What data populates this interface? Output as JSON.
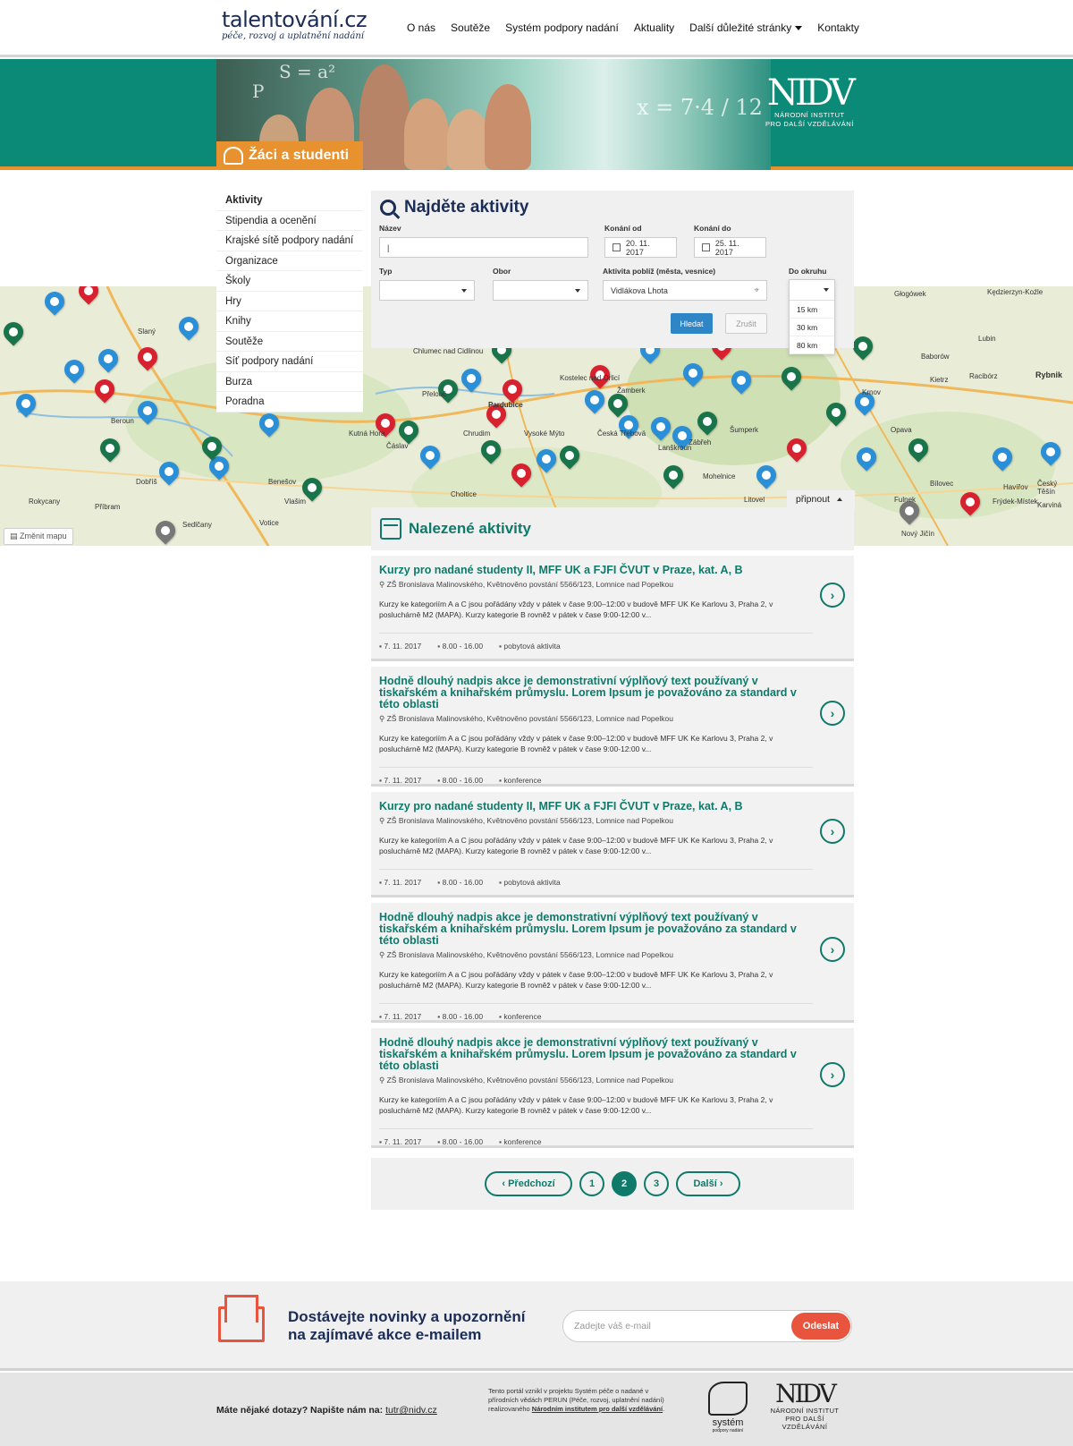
{
  "header": {
    "logo_main": "talentování.cz",
    "logo_sub": "péče, rozvoj a uplatnění nadání",
    "nav": [
      "O nás",
      "Soutěže",
      "Systém podpory nadání",
      "Aktuality",
      "Další důležité stránky",
      "Kontakty"
    ]
  },
  "banner": {
    "label": "Žáci a studenti",
    "nidv_big": "NIDV",
    "nidv_line1": "NÁRODNÍ INSTITUT",
    "nidv_line2": "PRO DALŠÍ VZDĚLÁVÁNÍ",
    "math1": "S = a²",
    "math2": "x = 7·4 / 12",
    "math3": "P"
  },
  "sidebar": {
    "items": [
      "Aktivity",
      "Stipendia a ocenění",
      "Krajské sítě podpory nadání",
      "Organizace",
      "Školy",
      "Hry",
      "Knihy",
      "Soutěže",
      "Síť podpory nadání",
      "Burza",
      "Poradna"
    ]
  },
  "search": {
    "title": "Najděte aktivity",
    "name_label": "Název",
    "name_value": "|",
    "from_label": "Konání od",
    "from_value": "20. 11. 2017",
    "to_label": "Konání do",
    "to_value": "25. 11. 2017",
    "type_label": "Typ",
    "field_label": "Obor",
    "near_label": "Aktivita poblíž (města, vesnice)",
    "near_value": "Vidlákova Lhota",
    "radius_label": "Do okruhu",
    "radius_options": [
      "15 km",
      "30 km",
      "80 km"
    ],
    "search_btn": "Hledat",
    "cancel_btn": "Zrušit"
  },
  "map": {
    "change_map": "Změnit mapu",
    "pin_label": "připnout",
    "cities": [
      "Slaný",
      "Beroun",
      "Příbram",
      "Rokycany",
      "Dobříš",
      "Benešov",
      "Vlašim",
      "Votice",
      "Sedlčany",
      "Kutná Hora",
      "Čáslav",
      "Chrudim",
      "Pardubice",
      "Vysoké Mýto",
      "Česká Třebová",
      "Lanškroun",
      "Zábřeh",
      "Šumperk",
      "Mohelnice",
      "Litovel",
      "Choltice",
      "Přelouč",
      "Kostelec nad Orlicí",
      "Žamberk",
      "Krnov",
      "Opava",
      "Bílovec",
      "Fulnek",
      "Nový Jičín",
      "Frýdek-Místek",
      "Havířov",
      "Český Těšín",
      "Karviná",
      "Rybnik",
      "Racibórz",
      "Kietrz",
      "Baborów",
      "Kędzierzyn-Koźle",
      "Głogówek",
      "Chlumec nad Cidlinou",
      "Lubin"
    ]
  },
  "results": {
    "title": "Nalezené aktivity",
    "cards": [
      {
        "title": "Kurzy pro nadané studenty II, MFF UK a FJFI ČVUT v Praze, kat. A, B",
        "addr": "ZŠ Bronislava Malinovského, Květnověno povstání 5566/123, Lomnice nad Popelkou",
        "desc": "Kurzy ke kategoriím A a C jsou pořádány vždy v pátek v čase 9:00–12:00 v budově MFF UK Ke Karlovu 3, Praha 2, v posluchárně M2 (MAPA). Kurzy kategorie B rovněž v pátek v čase 9:00-12:00 v...",
        "date": "7. 11. 2017",
        "time": "8.00 - 16.00",
        "kind": "pobytová aktivita"
      },
      {
        "title": "Hodně dlouhý nadpis akce je demonstrativní výplňový text používaný v tiskařském a knihařském průmyslu. Lorem Ipsum je považováno za standard v této oblasti",
        "addr": "ZŠ Bronislava Malinovského, Květnověno povstání 5566/123, Lomnice nad Popelkou",
        "desc": "Kurzy ke kategoriím A a C jsou pořádány vždy v pátek v čase 9:00–12:00 v budově MFF UK Ke Karlovu 3, Praha 2, v posluchárně M2 (MAPA). Kurzy kategorie B rovněž v pátek v čase 9:00-12:00 v...",
        "date": "7. 11. 2017",
        "time": "8.00 - 16.00",
        "kind": "konference"
      },
      {
        "title": "Kurzy pro nadané studenty II, MFF UK a FJFI ČVUT v Praze, kat. A, B",
        "addr": "ZŠ Bronislava Malinovského, Květnověno povstání 5566/123, Lomnice nad Popelkou",
        "desc": "Kurzy ke kategoriím A a C jsou pořádány vždy v pátek v čase 9:00–12:00 v budově MFF UK Ke Karlovu 3, Praha 2, v posluchárně M2 (MAPA). Kurzy kategorie B rovněž v pátek v čase 9:00-12:00 v...",
        "date": "7. 11. 2017",
        "time": "8.00 - 16.00",
        "kind": "pobytová aktivita"
      },
      {
        "title": "Hodně dlouhý nadpis akce je demonstrativní výplňový text používaný v tiskařském a knihařském průmyslu. Lorem Ipsum je považováno za standard v této oblasti",
        "addr": "ZŠ Bronislava Malinovského, Květnověno povstání 5566/123, Lomnice nad Popelkou",
        "desc": "Kurzy ke kategoriím A a C jsou pořádány vždy v pátek v čase 9:00–12:00 v budově MFF UK Ke Karlovu 3, Praha 2, v posluchárně M2 (MAPA). Kurzy kategorie B rovněž v pátek v čase 9:00-12:00 v...",
        "date": "7. 11. 2017",
        "time": "8.00 - 16.00",
        "kind": "konference"
      },
      {
        "title": "Hodně dlouhý nadpis akce je demonstrativní výplňový text používaný v tiskařském a knihařském průmyslu. Lorem Ipsum je považováno za standard v této oblasti",
        "addr": "ZŠ Bronislava Malinovského, Květnověno povstání 5566/123, Lomnice nad Popelkou",
        "desc": "Kurzy ke kategoriím A a C jsou pořádány vždy v pátek v čase 9:00–12:00 v budově MFF UK Ke Karlovu 3, Praha 2, v posluchárně M2 (MAPA). Kurzy kategorie B rovněž v pátek v čase 9:00-12:00 v...",
        "date": "7. 11. 2017",
        "time": "8.00 - 16.00",
        "kind": "konference"
      }
    ]
  },
  "pager": {
    "prev": "Předchozí",
    "pages": [
      "1",
      "2",
      "3"
    ],
    "current": "2",
    "next": "Další"
  },
  "newsletter": {
    "line1": "Dostávejte novinky a upozornění",
    "line2": "na zajímavé akce e-mailem",
    "placeholder": "Zadejte váš e-mail",
    "button": "Odeslat"
  },
  "footer": {
    "question": "Máte nějaké dotazy? Napište nám na:",
    "email": "tutr@nidv.cz",
    "note_pre": "Tento portál vznikl v projektu Systém péče o nadané v přírodních vědách PERUN (Péče, rozvoj, uplatnění nadání) realizovaného ",
    "note_link": "Národním institutem pro další vzdělávání",
    "note_post": ".",
    "system_label": "systém",
    "system_sub": "podpory nadání",
    "nidv_big": "NIDV",
    "nidv_line1": "NÁRODNÍ INSTITUT",
    "nidv_line2": "PRO DALŠÍ",
    "nidv_line3": "VZDĚLÁVÁNÍ"
  },
  "colors": {
    "teal": "#0f7a6a",
    "orange": "#e8912f",
    "navy": "#1b2d57",
    "red": "#e8543d"
  }
}
